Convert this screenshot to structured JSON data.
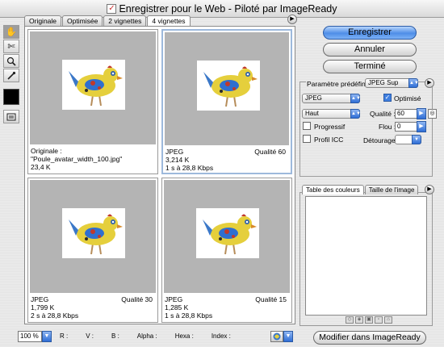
{
  "window": {
    "title": "Enregistrer pour le Web - Piloté par ImageReady"
  },
  "tools": [
    {
      "name": "hand-tool-icon",
      "glyph": "✋",
      "selected": true
    },
    {
      "name": "slice-select-tool-icon",
      "glyph": "✄",
      "selected": false
    },
    {
      "name": "zoom-tool-icon",
      "glyph": "🔍",
      "selected": false
    },
    {
      "name": "eyedropper-tool-icon",
      "glyph": "✎",
      "selected": false
    }
  ],
  "tabs": [
    "Originale",
    "Optimisée",
    "2 vignettes",
    "4 vignettes"
  ],
  "active_tab": 3,
  "panes": [
    {
      "line1": "Originale : \"Poule_avatar_width_100.jpg\"",
      "line2": "23,4 K",
      "line3": "",
      "quality": ""
    },
    {
      "line1": "JPEG",
      "line2": "3,214 K",
      "line3": "1 s à 28,8 Kbps",
      "quality": "Qualité 60"
    },
    {
      "line1": "JPEG",
      "line2": "1,799 K",
      "line3": "2 s à 28,8 Kbps",
      "quality": "Qualité 30"
    },
    {
      "line1": "JPEG",
      "line2": "1,285 K",
      "line3": "1 s à 28,8 Kbps",
      "quality": "Qualité 15"
    }
  ],
  "status": {
    "zoom": "100 %",
    "r": "R :",
    "v": "V :",
    "b": "B :",
    "alpha": "Alpha :",
    "hexa": "Hexa :",
    "index": "Index :"
  },
  "buttons": {
    "save": "Enregistrer",
    "cancel": "Annuler",
    "done": "Terminé",
    "edit_imageready": "Modifier dans ImageReady"
  },
  "settings": {
    "preset_label": "Paramètre prédéfini :",
    "preset_value": "JPEG Sup",
    "format": "JPEG",
    "optimized_label": "Optimisé",
    "optimized": true,
    "compression": "Haut",
    "quality_label": "Qualité :",
    "quality_value": "60",
    "progressive_label": "Progressif",
    "blur_label": "Flou :",
    "blur_value": "0",
    "icc_label": "Profil ICC",
    "matte_label": "Détourage :"
  },
  "color_panel": {
    "tabs": [
      "Table des couleurs",
      "Taille de l'image"
    ]
  },
  "colors": {
    "accent": "#3f7fe0",
    "thumb_bg": "#b4b4b4"
  }
}
